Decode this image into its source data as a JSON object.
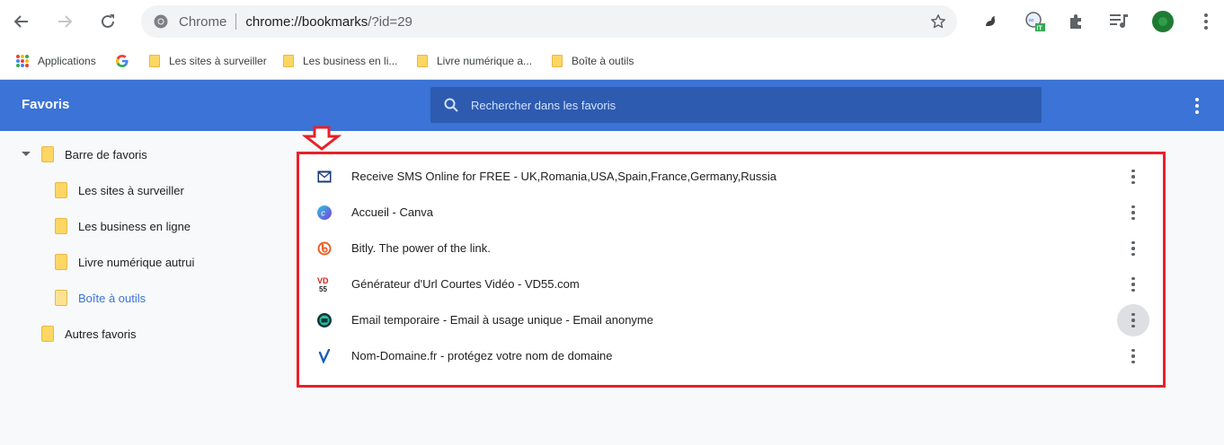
{
  "browser": {
    "omnibox": {
      "site_name": "Chrome",
      "url_host": "chrome://bookmarks",
      "url_rest": "/?id=29"
    }
  },
  "bookmarks_bar": {
    "apps_label": "Applications",
    "items": [
      {
        "label": "Les sites à surveiller"
      },
      {
        "label": "Les business en li..."
      },
      {
        "label": "Livre numérique a..."
      },
      {
        "label": "Boîte à outils"
      }
    ]
  },
  "header": {
    "title": "Favoris",
    "search_placeholder": "Rechercher dans les favoris"
  },
  "sidebar": {
    "root": "Barre de favoris",
    "children": [
      {
        "label": "Les sites à surveiller"
      },
      {
        "label": "Les business en ligne"
      },
      {
        "label": "Livre numérique autrui"
      },
      {
        "label": "Boîte à outils",
        "selected": true
      }
    ],
    "other": "Autres favoris"
  },
  "list": {
    "items": [
      {
        "title": "Receive SMS Online for FREE - UK,Romania,USA,Spain,France,Germany,Russia",
        "icon": "sms-mail-icon"
      },
      {
        "title": "Accueil - Canva",
        "icon": "canva-icon"
      },
      {
        "title": "Bitly. The power of the link.",
        "icon": "bitly-icon"
      },
      {
        "title": "Générateur d'Url Courtes Vidéo - VD55.com",
        "icon": "vd55-icon"
      },
      {
        "title": "Email temporaire - Email à usage unique - Email anonyme",
        "icon": "temp-mail-icon"
      },
      {
        "title": "Nom-Domaine.fr - protégez votre nom de domaine",
        "icon": "nom-domaine-icon"
      }
    ]
  },
  "colors": {
    "header_blue": "#3b73d6",
    "search_blue": "#2d5bb0",
    "annotation_red": "#e8202a",
    "folder_yellow": "#fdd663"
  }
}
